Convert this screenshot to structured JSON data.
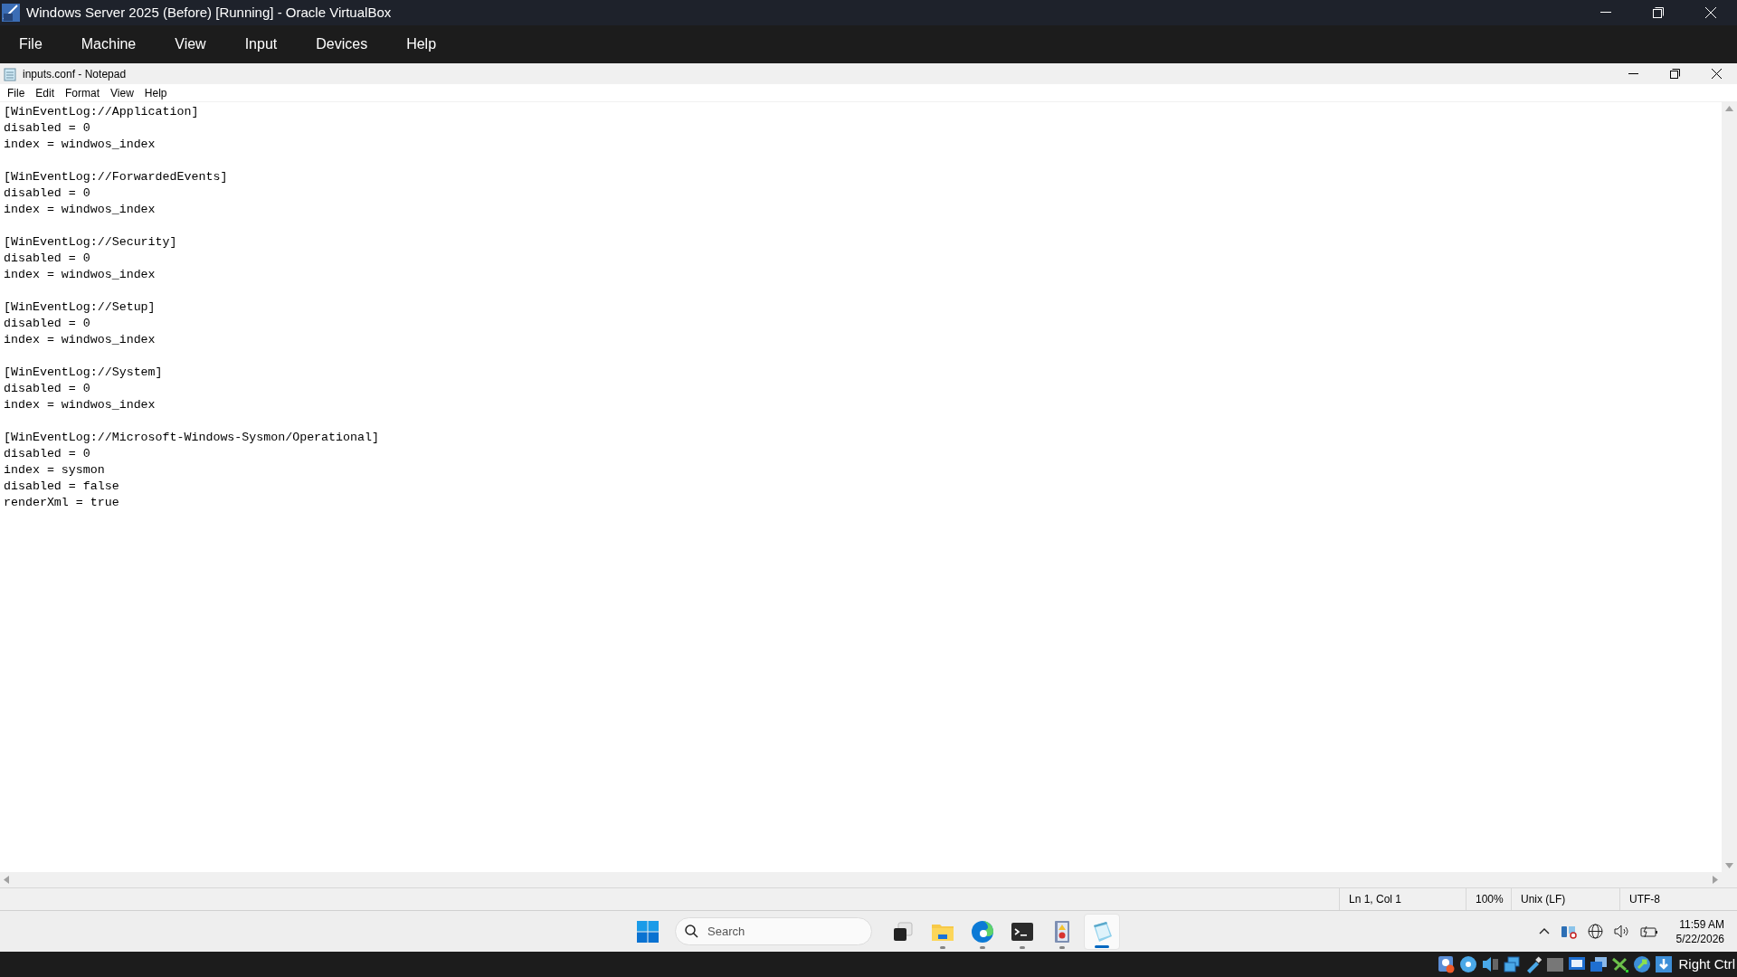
{
  "vbox_window": {
    "title": "Windows Server 2025 (Before) [Running] - Oracle VirtualBox"
  },
  "vbox_menu": [
    "File",
    "Machine",
    "View",
    "Input",
    "Devices",
    "Help"
  ],
  "notepad": {
    "title": "inputs.conf - Notepad",
    "menu": [
      "File",
      "Edit",
      "Format",
      "View",
      "Help"
    ],
    "sections": [
      [
        "[WinEventLog://Application]",
        "disabled = 0",
        "index = windwos_index"
      ],
      [
        "[WinEventLog://ForwardedEvents]",
        "disabled = 0",
        "index = windwos_index"
      ],
      [
        "[WinEventLog://Security]",
        "disabled = 0",
        "index = windwos_index"
      ],
      [
        "[WinEventLog://Setup]",
        "disabled = 0",
        "index = windwos_index"
      ],
      [
        "[WinEventLog://System]",
        "disabled = 0",
        "index = windwos_index"
      ],
      [
        "[WinEventLog://Microsoft-Windows-Sysmon/Operational]",
        "disabled = 0",
        "index = sysmon",
        "disabled = false",
        "renderXml = true"
      ]
    ],
    "status_bar": [
      "Ln 1, Col 1",
      "100%",
      "Unix (LF)",
      "UTF-8"
    ]
  },
  "taskbar": {
    "search": {
      "placeholder": "Search"
    },
    "apps": [
      {
        "kind": "taskview",
        "running": false,
        "selected": false
      },
      {
        "kind": "explorer",
        "running": true,
        "selected": false
      },
      {
        "kind": "edge",
        "running": true,
        "selected": false
      },
      {
        "kind": "terminal",
        "running": true,
        "selected": false
      },
      {
        "kind": "eventviewer",
        "running": true,
        "selected": false
      },
      {
        "kind": "notepad",
        "running": true,
        "selected": true
      }
    ],
    "time": "11:59 AM",
    "date": "5/22/2026"
  },
  "vbox_status": {
    "host_key": "Right Ctrl"
  }
}
